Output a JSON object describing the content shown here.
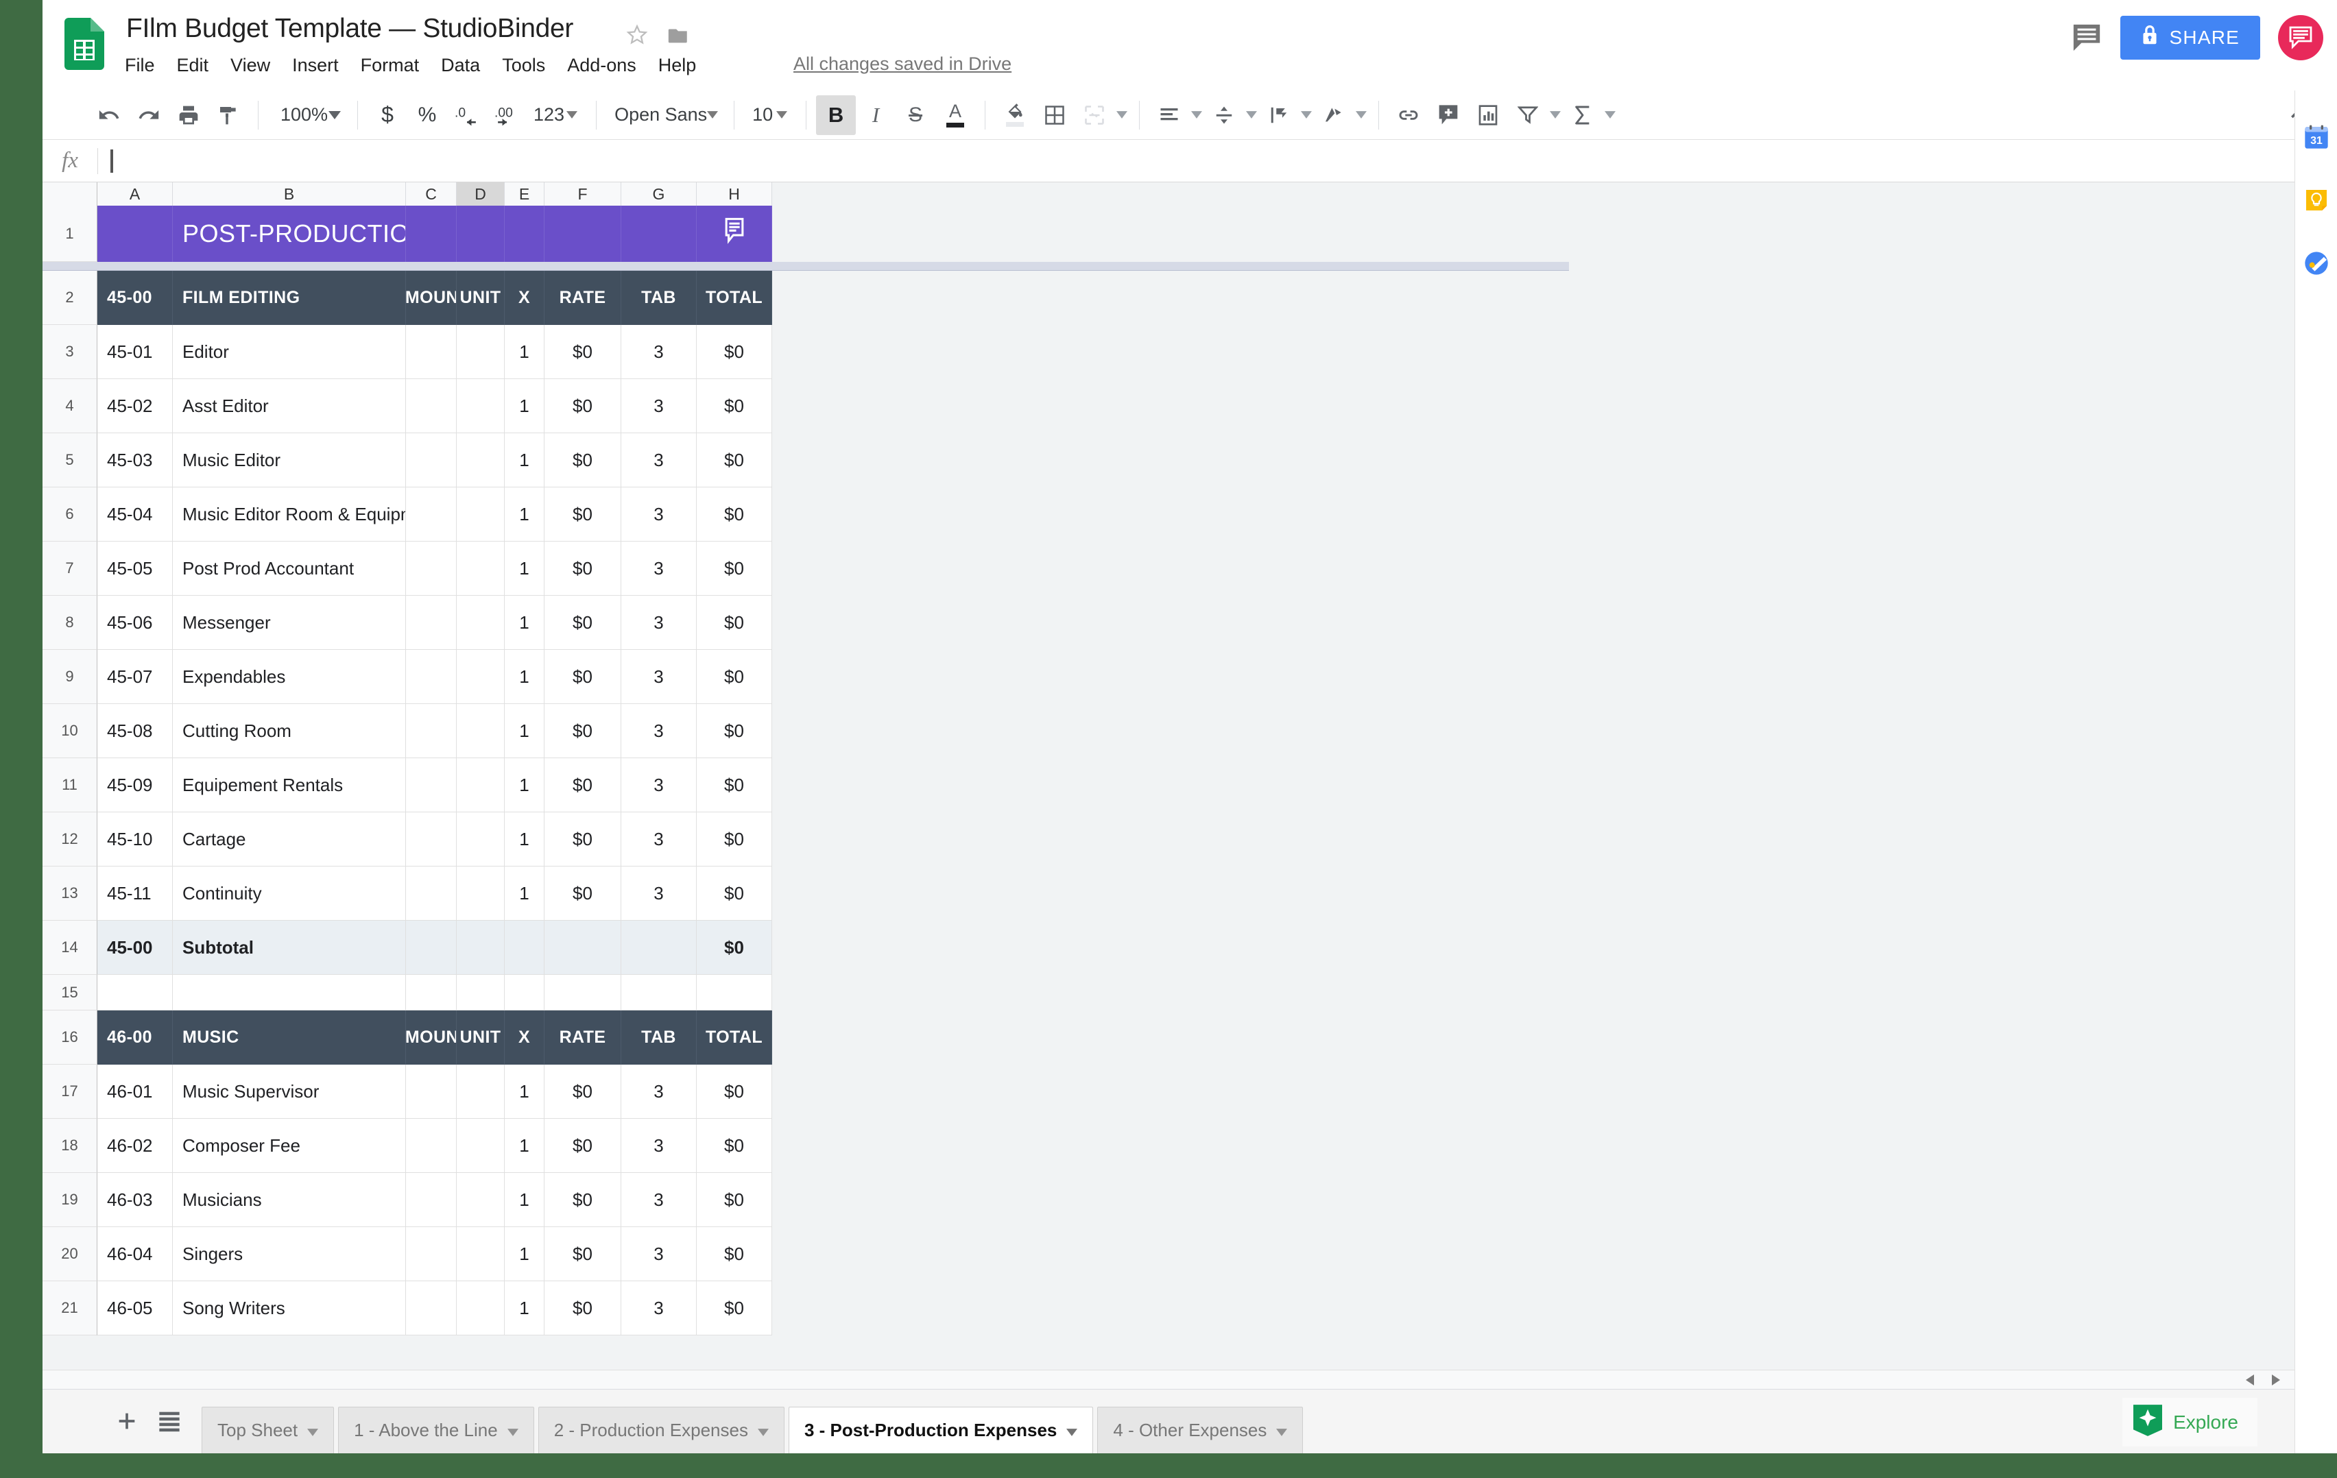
{
  "app": {
    "logo_icon": "google-sheets-icon",
    "title": "FIlm Budget Template — StudioBinder",
    "star_icon": "star-icon",
    "folder_icon": "folder-icon",
    "save_state": "All changes saved in Drive",
    "menus": [
      "File",
      "Edit",
      "View",
      "Insert",
      "Format",
      "Data",
      "Tools",
      "Add-ons",
      "Help"
    ],
    "comment_history_icon": "comment-history-icon",
    "share_label": "SHARE",
    "share_lock_icon": "lock-icon",
    "share_color": "#4285f4",
    "avatar_icon": "speech-bubble-avatar-icon",
    "avatar_color": "#e8295a"
  },
  "toolbar": {
    "undo_icon": "undo-icon",
    "redo_icon": "redo-icon",
    "print_icon": "print-icon",
    "paint_format_icon": "paint-format-icon",
    "zoom": "100%",
    "currency_icon": "currency-dollar-icon",
    "percent_icon": "percent-icon",
    "decrease_decimal_icon": "decrease-decimal-icon",
    "increase_decimal_icon": "increase-decimal-icon",
    "number_format_label": "123",
    "font_family": "Open Sans",
    "font_size": "10",
    "bold_label": "B",
    "bold_active": true,
    "italic_label": "I",
    "strikethrough_label": "S",
    "text_color_label": "A",
    "fill_color_icon": "fill-color-icon",
    "borders_icon": "borders-icon",
    "merge_cells_icon": "merge-cells-icon",
    "horizontal_align_icon": "horizontal-align-icon",
    "vertical_align_icon": "vertical-align-icon",
    "text_wrap_icon": "text-wrap-icon",
    "text_rotation_icon": "text-rotation-icon",
    "link_icon": "insert-link-icon",
    "comment_icon": "insert-comment-icon",
    "chart_icon": "insert-chart-icon",
    "filter_icon": "filter-icon",
    "functions_icon": "sum-functions-icon",
    "collapse_icon": "collapse-toolbar-icon"
  },
  "formula_bar": {
    "name_box": "",
    "fx_label": "fx",
    "value": "",
    "placeholder": ""
  },
  "grid": {
    "columns": [
      "A",
      "B",
      "C",
      "D",
      "E",
      "F",
      "G",
      "H"
    ],
    "selected_column": "D",
    "banner": {
      "row_number": "1",
      "title": "POST-PRODUCTION EXPENSES",
      "color": "#6a4fc9",
      "note_icon": "cell-note-icon"
    },
    "header_color": "#414f5e",
    "subtotal_color": "#eaeff3",
    "sections": [
      {
        "header": {
          "row_number": "2",
          "code": "45-00",
          "name": "FILM EDITING",
          "amount": "AMOUNT",
          "unit": "UNIT",
          "x": "X",
          "rate": "RATE",
          "tab": "TAB",
          "total": "TOTAL"
        },
        "rows": [
          {
            "row_number": "3",
            "code": "45-01",
            "desc": "Editor",
            "amount": "",
            "unit": "",
            "x": "1",
            "rate": "$0",
            "tab": "3",
            "total": "$0"
          },
          {
            "row_number": "4",
            "code": "45-02",
            "desc": "Asst Editor",
            "amount": "",
            "unit": "",
            "x": "1",
            "rate": "$0",
            "tab": "3",
            "total": "$0"
          },
          {
            "row_number": "5",
            "code": "45-03",
            "desc": "Music Editor",
            "amount": "",
            "unit": "",
            "x": "1",
            "rate": "$0",
            "tab": "3",
            "total": "$0"
          },
          {
            "row_number": "6",
            "code": "45-04",
            "desc": "Music Editor Room & Equipment",
            "amount": "",
            "unit": "",
            "x": "1",
            "rate": "$0",
            "tab": "3",
            "total": "$0"
          },
          {
            "row_number": "7",
            "code": "45-05",
            "desc": "Post Prod Accountant",
            "amount": "",
            "unit": "",
            "x": "1",
            "rate": "$0",
            "tab": "3",
            "total": "$0"
          },
          {
            "row_number": "8",
            "code": "45-06",
            "desc": "Messenger",
            "amount": "",
            "unit": "",
            "x": "1",
            "rate": "$0",
            "tab": "3",
            "total": "$0"
          },
          {
            "row_number": "9",
            "code": "45-07",
            "desc": "Expendables",
            "amount": "",
            "unit": "",
            "x": "1",
            "rate": "$0",
            "tab": "3",
            "total": "$0"
          },
          {
            "row_number": "10",
            "code": "45-08",
            "desc": "Cutting Room",
            "amount": "",
            "unit": "",
            "x": "1",
            "rate": "$0",
            "tab": "3",
            "total": "$0"
          },
          {
            "row_number": "11",
            "code": "45-09",
            "desc": "Equipement Rentals",
            "amount": "",
            "unit": "",
            "x": "1",
            "rate": "$0",
            "tab": "3",
            "total": "$0"
          },
          {
            "row_number": "12",
            "code": "45-10",
            "desc": "Cartage",
            "amount": "",
            "unit": "",
            "x": "1",
            "rate": "$0",
            "tab": "3",
            "total": "$0"
          },
          {
            "row_number": "13",
            "code": "45-11",
            "desc": "Continuity",
            "amount": "",
            "unit": "",
            "x": "1",
            "rate": "$0",
            "tab": "3",
            "total": "$0"
          }
        ],
        "subtotal": {
          "row_number": "14",
          "code": "45-00",
          "desc": "Subtotal",
          "amount": "",
          "unit": "",
          "x": "",
          "rate": "",
          "tab": "",
          "total": "$0"
        },
        "spacer": {
          "row_number": "15"
        }
      },
      {
        "header": {
          "row_number": "16",
          "code": "46-00",
          "name": "MUSIC",
          "amount": "AMOUNT",
          "unit": "UNIT",
          "x": "X",
          "rate": "RATE",
          "tab": "TAB",
          "total": "TOTAL"
        },
        "rows": [
          {
            "row_number": "17",
            "code": "46-01",
            "desc": "Music Supervisor",
            "amount": "",
            "unit": "",
            "x": "1",
            "rate": "$0",
            "tab": "3",
            "total": "$0"
          },
          {
            "row_number": "18",
            "code": "46-02",
            "desc": "Composer Fee",
            "amount": "",
            "unit": "",
            "x": "1",
            "rate": "$0",
            "tab": "3",
            "total": "$0"
          },
          {
            "row_number": "19",
            "code": "46-03",
            "desc": "Musicians",
            "amount": "",
            "unit": "",
            "x": "1",
            "rate": "$0",
            "tab": "3",
            "total": "$0"
          },
          {
            "row_number": "20",
            "code": "46-04",
            "desc": "Singers",
            "amount": "",
            "unit": "",
            "x": "1",
            "rate": "$0",
            "tab": "3",
            "total": "$0"
          },
          {
            "row_number": "21",
            "code": "46-05",
            "desc": "Song Writers",
            "amount": "",
            "unit": "",
            "x": "1",
            "rate": "$0",
            "tab": "3",
            "total": "$0"
          }
        ]
      }
    ]
  },
  "sheetbar": {
    "add_sheet_icon": "add-sheet-icon",
    "all_sheets_icon": "all-sheets-icon",
    "tabs": [
      {
        "label": "Top Sheet",
        "active": false
      },
      {
        "label": "1 - Above the Line",
        "active": false
      },
      {
        "label": "2 - Production Expenses",
        "active": false
      },
      {
        "label": "3 - Post-Production Expenses",
        "active": true
      },
      {
        "label": "4 - Other Expenses",
        "active": false
      }
    ],
    "explore_label": "Explore",
    "explore_icon": "explore-icon",
    "explore_color": "#34a853",
    "expand_panel_icon": "chevron-right-icon"
  },
  "sidepanel": {
    "items": [
      {
        "icon": "google-calendar-icon",
        "label": "31"
      },
      {
        "icon": "google-keep-icon",
        "label": ""
      },
      {
        "icon": "google-tasks-icon",
        "label": ""
      }
    ]
  }
}
